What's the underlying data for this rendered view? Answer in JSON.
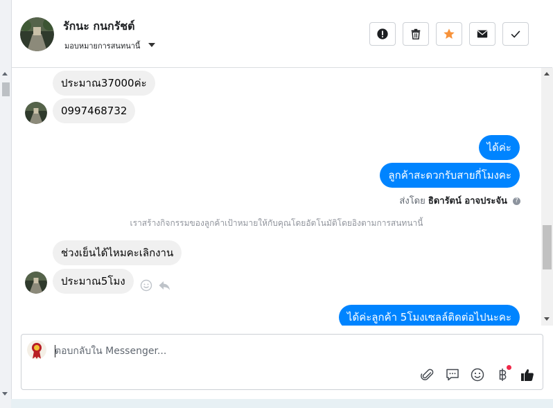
{
  "header": {
    "contact_name": "รักนะ กนกรัชต์",
    "assign_label": "มอบหมายการสนทนานี้",
    "actions": [
      {
        "name": "spam-button",
        "icon": "exclamation-icon"
      },
      {
        "name": "delete-button",
        "icon": "trash-icon"
      },
      {
        "name": "star-button",
        "icon": "star-icon",
        "color": "#f7923a"
      },
      {
        "name": "mark-unread-button",
        "icon": "envelope-icon"
      },
      {
        "name": "done-button",
        "icon": "checkmark-icon"
      }
    ]
  },
  "messages": {
    "incoming_1": "ประมาณ37000ค่ะ",
    "incoming_2": "0997468732",
    "outgoing_1": "ได้ค่ะ",
    "outgoing_2": "ลูกค้าสะดวกรับสายกี่โมงคะ",
    "sent_by_prefix": "ส่งโดย",
    "sent_by_name": "ธิดารัตน์ อาจประจัน",
    "system_note": "เราสร้างกิจกรรมของลูกค้าเป้าหมายให้กับคุณโดยอัตโนมัติโดยอิงตามการสนทนานี้",
    "incoming_3": "ช่วงเย็นได้ไหมคะเลิกงาน",
    "incoming_4": "ประมาณ5โมง",
    "outgoing_3": "ได้ค่ะลูกค้า 5โมงเซลล์ติดต่อไปนะคะ"
  },
  "composer": {
    "placeholder": "ตอบกลับใน Messenger...",
    "tools": [
      "attachment-icon",
      "saved-reply-icon",
      "emoji-icon",
      "baht-icon",
      "thumbs-up-icon"
    ]
  },
  "colors": {
    "outgoing_bubble": "#0084ff",
    "incoming_bubble": "#f0f0f0",
    "star": "#f7923a"
  }
}
